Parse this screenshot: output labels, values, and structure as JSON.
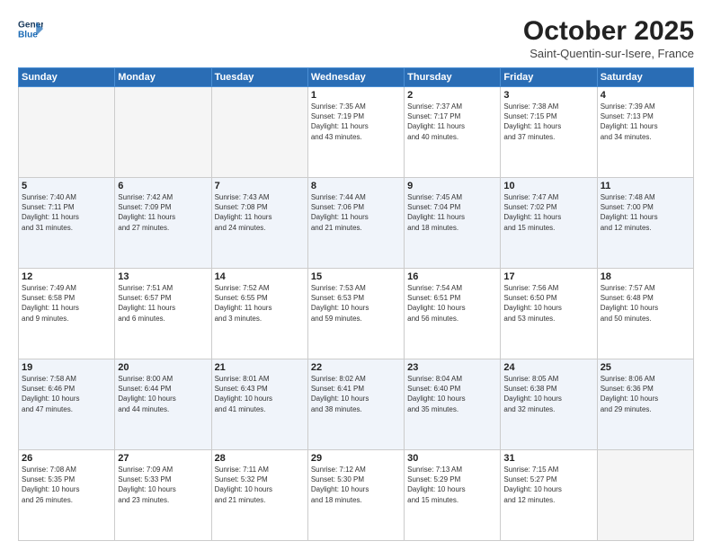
{
  "header": {
    "logo_line1": "General",
    "logo_line2": "Blue",
    "month": "October 2025",
    "location": "Saint-Quentin-sur-Isere, France"
  },
  "days_of_week": [
    "Sunday",
    "Monday",
    "Tuesday",
    "Wednesday",
    "Thursday",
    "Friday",
    "Saturday"
  ],
  "weeks": [
    [
      {
        "day": "",
        "info": ""
      },
      {
        "day": "",
        "info": ""
      },
      {
        "day": "",
        "info": ""
      },
      {
        "day": "1",
        "info": "Sunrise: 7:35 AM\nSunset: 7:19 PM\nDaylight: 11 hours\nand 43 minutes."
      },
      {
        "day": "2",
        "info": "Sunrise: 7:37 AM\nSunset: 7:17 PM\nDaylight: 11 hours\nand 40 minutes."
      },
      {
        "day": "3",
        "info": "Sunrise: 7:38 AM\nSunset: 7:15 PM\nDaylight: 11 hours\nand 37 minutes."
      },
      {
        "day": "4",
        "info": "Sunrise: 7:39 AM\nSunset: 7:13 PM\nDaylight: 11 hours\nand 34 minutes."
      }
    ],
    [
      {
        "day": "5",
        "info": "Sunrise: 7:40 AM\nSunset: 7:11 PM\nDaylight: 11 hours\nand 31 minutes."
      },
      {
        "day": "6",
        "info": "Sunrise: 7:42 AM\nSunset: 7:09 PM\nDaylight: 11 hours\nand 27 minutes."
      },
      {
        "day": "7",
        "info": "Sunrise: 7:43 AM\nSunset: 7:08 PM\nDaylight: 11 hours\nand 24 minutes."
      },
      {
        "day": "8",
        "info": "Sunrise: 7:44 AM\nSunset: 7:06 PM\nDaylight: 11 hours\nand 21 minutes."
      },
      {
        "day": "9",
        "info": "Sunrise: 7:45 AM\nSunset: 7:04 PM\nDaylight: 11 hours\nand 18 minutes."
      },
      {
        "day": "10",
        "info": "Sunrise: 7:47 AM\nSunset: 7:02 PM\nDaylight: 11 hours\nand 15 minutes."
      },
      {
        "day": "11",
        "info": "Sunrise: 7:48 AM\nSunset: 7:00 PM\nDaylight: 11 hours\nand 12 minutes."
      }
    ],
    [
      {
        "day": "12",
        "info": "Sunrise: 7:49 AM\nSunset: 6:58 PM\nDaylight: 11 hours\nand 9 minutes."
      },
      {
        "day": "13",
        "info": "Sunrise: 7:51 AM\nSunset: 6:57 PM\nDaylight: 11 hours\nand 6 minutes."
      },
      {
        "day": "14",
        "info": "Sunrise: 7:52 AM\nSunset: 6:55 PM\nDaylight: 11 hours\nand 3 minutes."
      },
      {
        "day": "15",
        "info": "Sunrise: 7:53 AM\nSunset: 6:53 PM\nDaylight: 10 hours\nand 59 minutes."
      },
      {
        "day": "16",
        "info": "Sunrise: 7:54 AM\nSunset: 6:51 PM\nDaylight: 10 hours\nand 56 minutes."
      },
      {
        "day": "17",
        "info": "Sunrise: 7:56 AM\nSunset: 6:50 PM\nDaylight: 10 hours\nand 53 minutes."
      },
      {
        "day": "18",
        "info": "Sunrise: 7:57 AM\nSunset: 6:48 PM\nDaylight: 10 hours\nand 50 minutes."
      }
    ],
    [
      {
        "day": "19",
        "info": "Sunrise: 7:58 AM\nSunset: 6:46 PM\nDaylight: 10 hours\nand 47 minutes."
      },
      {
        "day": "20",
        "info": "Sunrise: 8:00 AM\nSunset: 6:44 PM\nDaylight: 10 hours\nand 44 minutes."
      },
      {
        "day": "21",
        "info": "Sunrise: 8:01 AM\nSunset: 6:43 PM\nDaylight: 10 hours\nand 41 minutes."
      },
      {
        "day": "22",
        "info": "Sunrise: 8:02 AM\nSunset: 6:41 PM\nDaylight: 10 hours\nand 38 minutes."
      },
      {
        "day": "23",
        "info": "Sunrise: 8:04 AM\nSunset: 6:40 PM\nDaylight: 10 hours\nand 35 minutes."
      },
      {
        "day": "24",
        "info": "Sunrise: 8:05 AM\nSunset: 6:38 PM\nDaylight: 10 hours\nand 32 minutes."
      },
      {
        "day": "25",
        "info": "Sunrise: 8:06 AM\nSunset: 6:36 PM\nDaylight: 10 hours\nand 29 minutes."
      }
    ],
    [
      {
        "day": "26",
        "info": "Sunrise: 7:08 AM\nSunset: 5:35 PM\nDaylight: 10 hours\nand 26 minutes."
      },
      {
        "day": "27",
        "info": "Sunrise: 7:09 AM\nSunset: 5:33 PM\nDaylight: 10 hours\nand 23 minutes."
      },
      {
        "day": "28",
        "info": "Sunrise: 7:11 AM\nSunset: 5:32 PM\nDaylight: 10 hours\nand 21 minutes."
      },
      {
        "day": "29",
        "info": "Sunrise: 7:12 AM\nSunset: 5:30 PM\nDaylight: 10 hours\nand 18 minutes."
      },
      {
        "day": "30",
        "info": "Sunrise: 7:13 AM\nSunset: 5:29 PM\nDaylight: 10 hours\nand 15 minutes."
      },
      {
        "day": "31",
        "info": "Sunrise: 7:15 AM\nSunset: 5:27 PM\nDaylight: 10 hours\nand 12 minutes."
      },
      {
        "day": "",
        "info": ""
      }
    ]
  ]
}
